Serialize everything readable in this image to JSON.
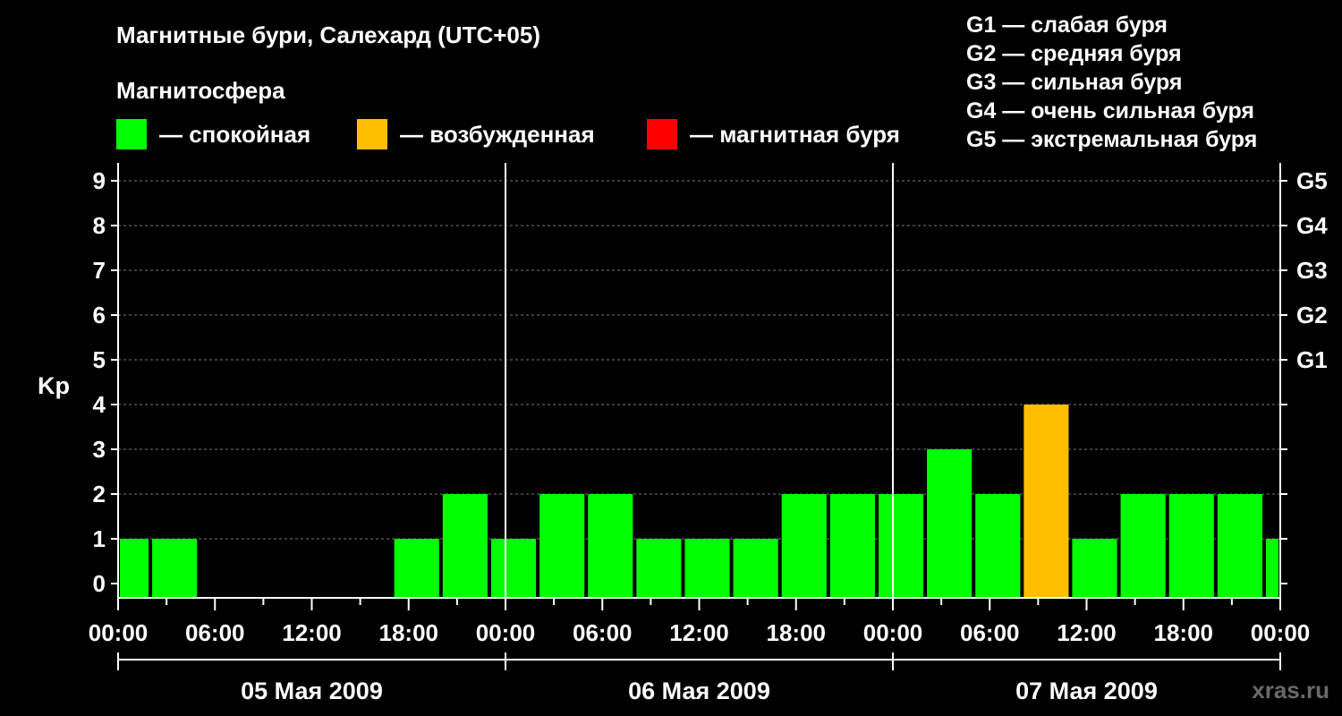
{
  "title": "Магнитные бури, Салехард (UTC+05)",
  "subtitle": "Магнитосфера",
  "legend": [
    {
      "label": "— спокойная",
      "color": "#00ff00"
    },
    {
      "label": "— возбужденная",
      "color": "#ffbf00"
    },
    {
      "label": "— магнитная буря",
      "color": "#ff0000"
    }
  ],
  "storm_legend": [
    "G1 — слабая буря",
    "G2 — средняя буря",
    "G3 — сильная буря",
    "G4 — очень сильная буря",
    "G5 — экстремальная буря"
  ],
  "watermark": "xras.ru",
  "chart_data": {
    "type": "bar",
    "ylabel": "Kp",
    "ylim": [
      0,
      9
    ],
    "yticks": [
      0,
      1,
      2,
      3,
      4,
      5,
      6,
      7,
      8,
      9
    ],
    "right_ticks": [
      {
        "value": 5,
        "label": "G1"
      },
      {
        "value": 6,
        "label": "G2"
      },
      {
        "value": 7,
        "label": "G3"
      },
      {
        "value": 8,
        "label": "G4"
      },
      {
        "value": 9,
        "label": "G5"
      }
    ],
    "grid": true,
    "xlim_hours": [
      0,
      72
    ],
    "xtick_labels": [
      "00:00",
      "06:00",
      "12:00",
      "18:00",
      "00:00",
      "06:00",
      "12:00",
      "18:00",
      "00:00",
      "06:00",
      "12:00",
      "18:00",
      "00:00"
    ],
    "days": [
      "05 Мая 2009",
      "06 Мая 2009",
      "07 Мая 2009"
    ],
    "bars": [
      {
        "start": "05 Мая 2009 00:00",
        "end": "05 Мая 2009 02:00",
        "kp": 1,
        "color": "#00ff00"
      },
      {
        "start": "05 Мая 2009 02:00",
        "end": "05 Мая 2009 05:00",
        "kp": 1,
        "color": "#00ff00"
      },
      {
        "start": "05 Мая 2009 17:00",
        "end": "05 Мая 2009 20:00",
        "kp": 1,
        "color": "#00ff00"
      },
      {
        "start": "05 Мая 2009 20:00",
        "end": "05 Мая 2009 23:00",
        "kp": 2,
        "color": "#00ff00"
      },
      {
        "start": "05 Мая 2009 23:00",
        "end": "06 Мая 2009 02:00",
        "kp": 1,
        "color": "#00ff00"
      },
      {
        "start": "06 Мая 2009 02:00",
        "end": "06 Мая 2009 05:00",
        "kp": 2,
        "color": "#00ff00"
      },
      {
        "start": "06 Мая 2009 05:00",
        "end": "06 Мая 2009 08:00",
        "kp": 2,
        "color": "#00ff00"
      },
      {
        "start": "06 Мая 2009 08:00",
        "end": "06 Мая 2009 11:00",
        "kp": 1,
        "color": "#00ff00"
      },
      {
        "start": "06 Мая 2009 11:00",
        "end": "06 Мая 2009 14:00",
        "kp": 1,
        "color": "#00ff00"
      },
      {
        "start": "06 Мая 2009 14:00",
        "end": "06 Мая 2009 17:00",
        "kp": 1,
        "color": "#00ff00"
      },
      {
        "start": "06 Мая 2009 17:00",
        "end": "06 Мая 2009 20:00",
        "kp": 2,
        "color": "#00ff00"
      },
      {
        "start": "06 Мая 2009 20:00",
        "end": "06 Мая 2009 23:00",
        "kp": 2,
        "color": "#00ff00"
      },
      {
        "start": "06 Мая 2009 23:00",
        "end": "07 Мая 2009 02:00",
        "kp": 2,
        "color": "#00ff00"
      },
      {
        "start": "07 Мая 2009 02:00",
        "end": "07 Мая 2009 05:00",
        "kp": 3,
        "color": "#00ff00"
      },
      {
        "start": "07 Мая 2009 05:00",
        "end": "07 Мая 2009 08:00",
        "kp": 2,
        "color": "#00ff00"
      },
      {
        "start": "07 Мая 2009 08:00",
        "end": "07 Мая 2009 11:00",
        "kp": 4,
        "color": "#ffbf00"
      },
      {
        "start": "07 Мая 2009 11:00",
        "end": "07 Мая 2009 14:00",
        "kp": 1,
        "color": "#00ff00"
      },
      {
        "start": "07 Мая 2009 14:00",
        "end": "07 Мая 2009 17:00",
        "kp": 2,
        "color": "#00ff00"
      },
      {
        "start": "07 Мая 2009 17:00",
        "end": "07 Мая 2009 20:00",
        "kp": 2,
        "color": "#00ff00"
      },
      {
        "start": "07 Мая 2009 20:00",
        "end": "07 Мая 2009 23:00",
        "kp": 2,
        "color": "#00ff00"
      },
      {
        "start": "07 Мая 2009 23:00",
        "end": "08 Мая 2009 00:00",
        "kp": 1,
        "color": "#00ff00"
      }
    ]
  }
}
